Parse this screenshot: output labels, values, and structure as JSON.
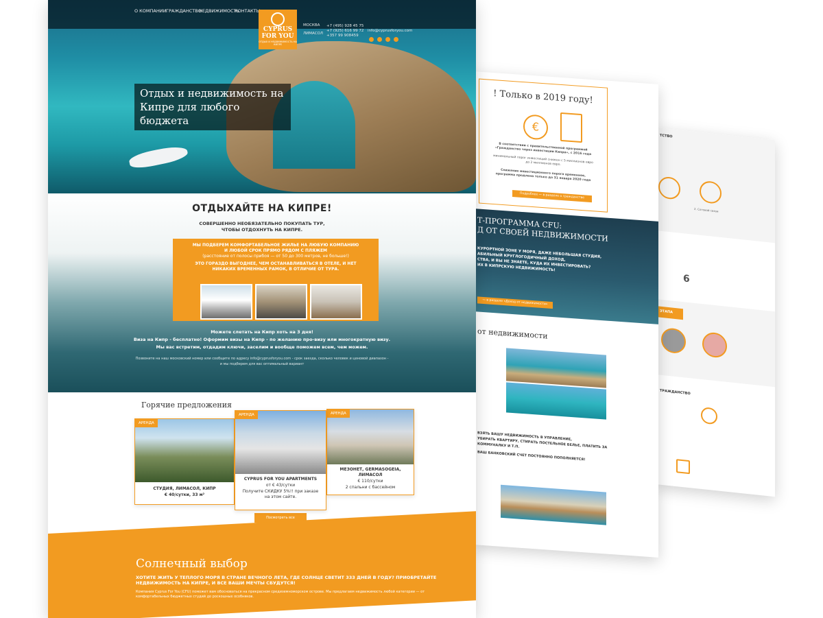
{
  "colors": {
    "accent": "#f29b21",
    "dark_overlay": "#06141c",
    "text": "#333333"
  },
  "main_page": {
    "nav": [
      "О КОМПАНИИ",
      "ГРАЖДАНСТВО",
      "НЕДВИЖИМОСТЬ",
      "КОНТАКТЫ"
    ],
    "logo": {
      "line1": "CYPRUS",
      "line2": "FOR YOU",
      "tagline": "ОТДЫХ И НЕДВИЖИМОСТЬ НА КИПРЕ",
      "icon": "globe-icon"
    },
    "contacts": {
      "city1": "МОСКВА",
      "city2": "ЛИМАСОЛ",
      "phones": [
        "+7 (495) 928 45 75",
        "+7 (925) 616 99 72",
        "+357 99 908459"
      ],
      "email": "info@cyprusforyou.com",
      "social_icons": [
        "vk-icon",
        "facebook-icon",
        "twitter-icon",
        "instagram-icon"
      ]
    },
    "hero": {
      "title": "Отдых и недвижимость на Кипре для любого бюджета"
    },
    "rest": {
      "title": "ОТДЫХАЙТЕ НА КИПРЕ!",
      "subtitle_1": "СОВЕРШЕННО НЕОБЯЗАТЕЛЬНО ПОКУПАТЬ ТУР,",
      "subtitle_2": "ЧТОБЫ ОТДОХНУТЬ НА КИПРЕ.",
      "box_1": "МЫ ПОДБЕРЕМ КОМФОРТАБЕЛЬНОЕ ЖИЛЬЕ НА ЛЮБУЮ КОМПАНИЮ",
      "box_2": "И ЛЮБОЙ СРОК ПРЯМО РЯДОМ С ПЛЯЖЕМ",
      "box_3": "(расстояние от полосы прибоя — от 50 до 300 метров, не больше!)",
      "box_4": "ЭТО ГОРАЗДО ВЫГОДНЕЕ, ЧЕМ ОСТАНАВЛИВАТЬСЯ В ОТЕЛЕ, И НЕТ",
      "box_5": "НИКАКИХ ВРЕМЕННЫХ РАМОК, В ОТЛИЧИЕ ОТ ТУРА.",
      "foot_1": "Можете слетать на Кипр хоть на 3 дня!",
      "foot_2": "Виза на Кипр - бесплатно! Оформим визы на Кипр - по желанию про-визу или многократную визу.",
      "foot_3": "Мы вас встретим, отдадим ключи, заселим и вообще поможем всем, чем можем.",
      "small_1": "Позвоните на наш московский номер или сообщите по адресу info@cyprusforyou.com - срок заезда, сколько человек и ценовой диапазон -",
      "small_2": "и мы подберем для вас оптимальный вариант"
    },
    "hot": {
      "title": "Горячие предложения",
      "cards": [
        {
          "tag": "АРЕНДА",
          "title": "СТУДИЯ, ЛИМАСОЛ, КИПР",
          "price": "€ 40/сутки, 33 м²"
        },
        {
          "tag": "АРЕНДА",
          "title": "CYPRUS FOR YOU APARTMENTS",
          "price": "от € 43/сутки",
          "note_1": "Получите СКИДКУ 5%!! при заказе",
          "note_2": "на этом сайте."
        },
        {
          "tag": "АРЕНДА",
          "title": "МЕЗОНЕТ, GERMASOGEIA,",
          "title_2": "ЛИМАСОЛ",
          "price": "€ 110/сутки",
          "note_1": "2 спальни с бассейном"
        }
      ],
      "more_button": "Посмотреть все"
    },
    "sunny": {
      "title": "Солнечный выбор",
      "subtitle": "ХОТИТЕ ЖИТЬ У ТЕПЛОГО МОРЯ В СТРАНЕ ВЕЧНОГО ЛЕТА, ГДЕ СОЛНЦЕ СВЕТИТ 333 ДНЕЙ В ГОДУ? ПРИОБРЕТАЙТЕ НЕДВИЖИМОСТЬ НА КИПРЕ, И ВСЕ ВАШИ МЕЧТЫ СБУДУТСЯ!",
      "body": "Компания Cyprus For You (CFU) поможет вам обосноваться на прекрасном средиземноморском острове. Мы предлагаем недвижимость любой категории — от комфортабельных бюджетных студий до роскошных особняков."
    }
  },
  "middle_page": {
    "citizenship_title": "! Только в 2019 году!",
    "citizenship_text_1": "В соответствии с правительственной программой «Гражданство через инвестиции Кипра», с 2016 года",
    "citizenship_text_2": "минимальный порог инвестиций снижен с 5 миллионов евро до 2 миллионов евро.",
    "citizenship_text_3": "Снижение инвестиционного порога временное, программа продлена только до 31 января 2020 года",
    "citizenship_button": "Подробнее — в разделе о гражданстве",
    "invest_title_1": "Т-ПРОГРАММА CFU:",
    "invest_title_2": "Д ОТ СВОЕЙ НЕДВИЖИМОСТИ",
    "invest_text_1": "КУРОРТНОЙ ЗОНЕ У МОРЯ, ДАЖЕ НЕБОЛЬШАЯ СТУДИЯ,",
    "invest_text_2": "АБИЛЬНЫЙ КРУГЛОГОДИЧНЫЙ ДОХОД,",
    "invest_text_3": "СТВА, И ВЫ НЕ ЗНАЕТЕ, КУДА ИХ ИНВЕСТИРОВАТЬ?",
    "invest_text_4": "ИХ В КИПРСКУЮ НЕДВИЖИМОСТЬ!",
    "invest_button": "— в разделе «Доход от недвижимости»",
    "income_title": "от недвижимости",
    "income_text_1": "ВЗЯТЬ ВАШУ НЕДВИЖИМОСТЬ В УПРАВЛЕНИЕ,",
    "income_text_2": "УБИРАТЬ КВАРТИРУ, СТИРАТЬ ПОСТЕЛЬНОЕ БЕЛЬЕ, ПЛАТИТЬ ЗА",
    "income_text_3": "КОММУНАЛКУ И Т.П.",
    "income_text_4": "ВАШ БАНКОВСКИЙ СЧЕТ ПОСТОЯННО ПОПОЛНЯЕТСЯ!"
  },
  "back_page": {
    "title_1": "ТСТВО",
    "title_2": "ЭТАПА",
    "note_1": "2. Сотовой связи",
    "note_2": "6",
    "note_3": "ТРАЖДАНСТВО"
  }
}
